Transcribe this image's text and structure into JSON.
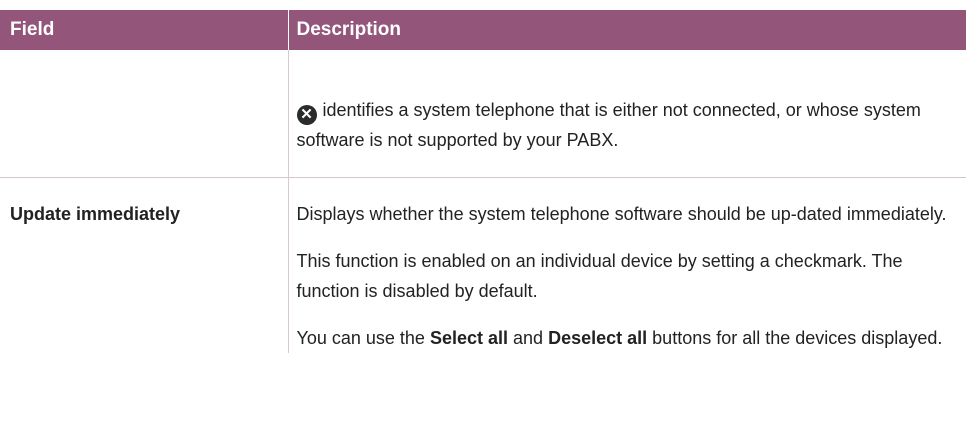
{
  "table": {
    "headers": {
      "field": "Field",
      "description": "Description"
    },
    "rows": [
      {
        "field": "",
        "icon": "not-connected-icon",
        "description": "identifies a system telephone that is either not connected, or whose system software is not supported by your PABX."
      },
      {
        "field": "Update immediately",
        "paragraphs": [
          "Displays whether the system telephone software should be up-dated immediately.",
          "This function is enabled on an individual device by setting a checkmark. The function is disabled by default."
        ],
        "buttons_paragraph": {
          "prefix": "You can use the",
          "select_all": "Select all",
          "and": "and",
          "deselect_all": "Deselect all",
          "suffix": "buttons for all the devices displayed."
        }
      }
    ]
  },
  "colors": {
    "header_bg": "#93557a",
    "header_text": "#ffffff"
  },
  "icons": {
    "not_connected_glyph": "✕"
  }
}
